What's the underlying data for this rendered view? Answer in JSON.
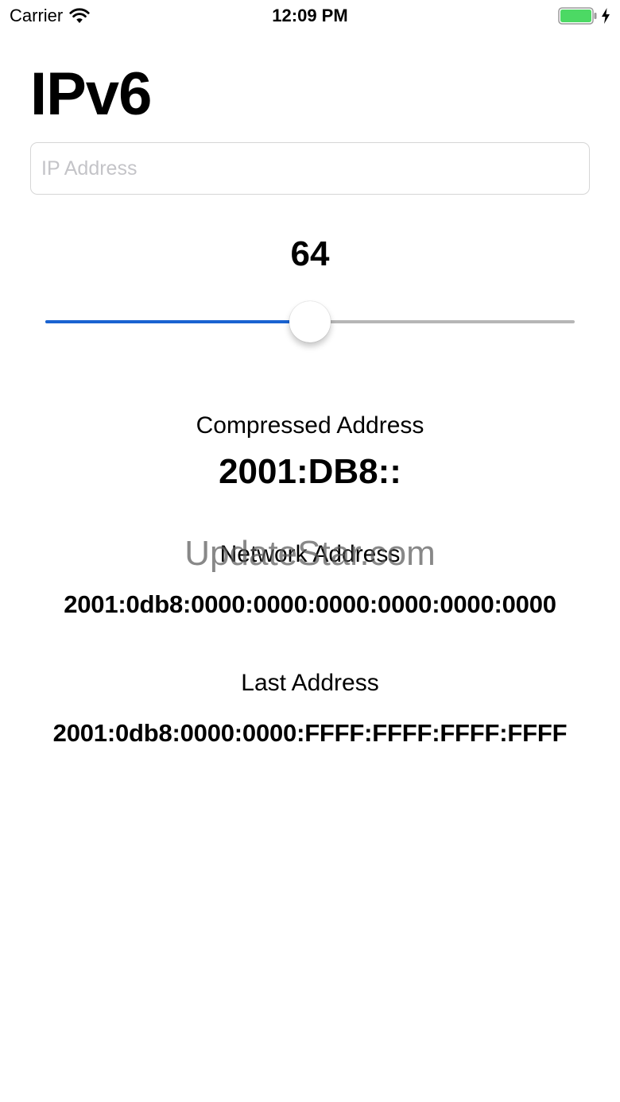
{
  "status_bar": {
    "carrier": "Carrier",
    "time": "12:09 PM",
    "wifi_icon": "wifi-icon",
    "battery_icon": "battery-icon",
    "charging_icon": "charging-bolt-icon",
    "battery_color": "#4cd964"
  },
  "title": "IPv6",
  "ip_input": {
    "placeholder": "IP Address",
    "value": ""
  },
  "prefix": {
    "value": "64",
    "slider_min": 0,
    "slider_max": 128,
    "slider_value": 64,
    "min_track_color": "#1a63d1",
    "max_track_color": "#b6b6b6"
  },
  "compressed": {
    "label": "Compressed Address",
    "value": "2001:DB8::"
  },
  "network": {
    "label": "Network Address",
    "value": "2001:0db8:0000:0000:0000:0000:0000:0000"
  },
  "last": {
    "label": "Last Address",
    "value": "2001:0db8:0000:0000:FFFF:FFFF:FFFF:FFFF"
  },
  "watermark": "UpdateStar.com"
}
